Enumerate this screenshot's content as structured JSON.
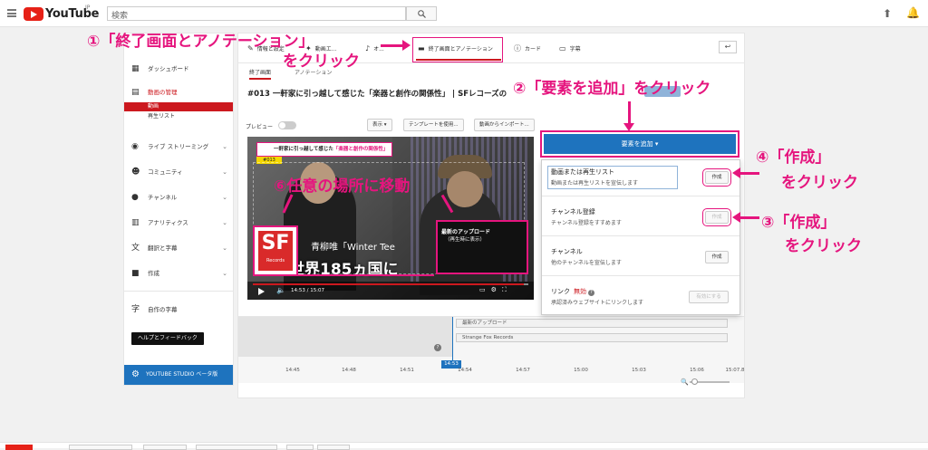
{
  "topbar": {
    "logo_text": "YouTube",
    "logo_region": "JP",
    "search_placeholder": "検索"
  },
  "sidebar": {
    "items": [
      {
        "icon": "dashboard-icon",
        "label": "ダッシュボード"
      },
      {
        "icon": "video-manager-icon",
        "label": "動画の管理"
      },
      {
        "icon": "live-icon",
        "label": "ライブ ストリーミング"
      },
      {
        "icon": "community-icon",
        "label": "コミュニティ"
      },
      {
        "icon": "channel-icon",
        "label": "チャンネル"
      },
      {
        "icon": "analytics-icon",
        "label": "アナリティクス"
      },
      {
        "icon": "translate-icon",
        "label": "翻訳と字幕"
      },
      {
        "icon": "create-icon",
        "label": "作成"
      },
      {
        "icon": "subtitles-icon",
        "label": "自作の字幕"
      }
    ],
    "sub_items": [
      "動画",
      "再生リスト"
    ],
    "help_button": "ヘルプとフィードバック",
    "studio_button": "YOUTUBE STUDIO ベータ版"
  },
  "main": {
    "tabs": [
      {
        "icon": "edit-icon",
        "label": "情報と設定"
      },
      {
        "icon": "enhance-icon",
        "label": "動画エ..."
      },
      {
        "icon": "audio-icon",
        "label": "オ..."
      },
      {
        "icon": "endscreen-icon",
        "label": "終了画面とアノテーション"
      },
      {
        "icon": "info-icon",
        "label": "カード"
      },
      {
        "icon": "cc-icon",
        "label": "字幕"
      }
    ],
    "back_label": "↩",
    "subtabs": [
      "終了画面",
      "アノテーション"
    ],
    "video_title": "#013 一軒家に引っ越して感じた「楽器と創作の関係性」 | SFレコーズの",
    "preview_label": "プレビュー",
    "toolbar_buttons": [
      "表示 ▾",
      "テンプレートを使用...",
      "動画からインポート..."
    ]
  },
  "player": {
    "banner_prefix": "一軒家に引っ越して感じた",
    "banner_highlight": "「楽器と創作の関係性」",
    "episode": "#013",
    "sf_logo": "SF",
    "sf_sub": "Records",
    "latest_title": "最新のアップロード",
    "latest_sub": "（再生時に表示）",
    "singer_caption": "青柳唯「Winter Tee",
    "big_caption": "世界185ヵ国に",
    "time": "14:53 / 15:07",
    "progress": 0.985
  },
  "timeline": {
    "tracks": [
      "最新のアップロード",
      "Strange Fox Records"
    ],
    "cursor_label": "14:53",
    "ticks": [
      "14:45",
      "14:48",
      "14:51",
      "14:54",
      "14:57",
      "15:00",
      "15:03",
      "15:06",
      "15:07.8"
    ]
  },
  "dropdown": {
    "add_button": "要素を追加",
    "rows": [
      {
        "title": "動画または再生リスト",
        "subtitle": "動画または再生リストを宣伝します",
        "button": "作成",
        "state": "enabled"
      },
      {
        "title": "チャンネル登録",
        "subtitle": "チャンネル登録をすすめます",
        "button": "作成",
        "state": "disabled"
      },
      {
        "title": "チャンネル",
        "subtitle": "他のチャンネルを宣伝します",
        "button": "作成",
        "state": "enabled"
      },
      {
        "title": "リンク",
        "subtitle": "承認済みウェブサイトにリンクします",
        "button": "有効にする",
        "state": "disabled",
        "badge": "無効"
      }
    ]
  },
  "annotations": {
    "step1": "①「終了画面とアノテーション」",
    "step1b": "をクリック",
    "step2": "②「要素を追加」をクリック",
    "step3": "③「作成」",
    "step3b": "をクリック",
    "step4": "④「作成」",
    "step4b": "をクリック",
    "step6": "⑥任意の場所に移動",
    "accent_color": "#e5157e"
  }
}
